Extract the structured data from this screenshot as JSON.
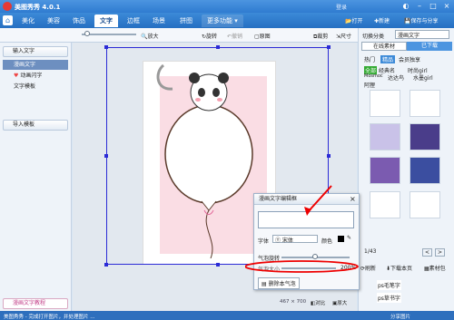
{
  "window": {
    "title": "美图秀秀 4.0.1",
    "login": "登录"
  },
  "menu": {
    "tabs": [
      "美化",
      "美容",
      "饰品",
      "文字",
      "边框",
      "场景",
      "拼图",
      "更多功能"
    ],
    "active": "文字"
  },
  "top_tools": {
    "open": "打开",
    "new": "新建",
    "save": "保存与分享"
  },
  "toolbar": {
    "zoom_label": "放大",
    "rotate": "旋转",
    "redo": "撤销",
    "original": "原图",
    "cut": "裁剪",
    "size": "尺寸"
  },
  "left": {
    "input_text": "输入文字",
    "selected": "漫画文字",
    "anim": "动画闪字",
    "template": "文字模板",
    "import": "导入模板"
  },
  "right": {
    "category_label": "切换分类",
    "category_value": "漫画文字",
    "tab_online": "在线素材",
    "tab_used": "已下载",
    "subtabs": [
      "热门",
      "精品",
      "会员独享"
    ],
    "tags": [
      "全部",
      "经典名",
      "时尚girl",
      "Mosmoc",
      "达达鸟",
      "水墨girl",
      "阿狸"
    ],
    "page": "1/43",
    "pagebtns": [
      "<",
      ">"
    ],
    "refresh": "刷新",
    "download": "下载本页",
    "materials": "素材包",
    "suffix1": "ps毛笔字",
    "suffix2": "ps草书字"
  },
  "dialog": {
    "title": "漫画文字编辑框",
    "font_label": "字体",
    "font_value": "宋体",
    "color_label": "颜色",
    "bubble_rotate": "气泡旋转",
    "bubble_size": "气泡大小",
    "size_value": "200%",
    "delete": "删除本气泡"
  },
  "canvas": {
    "size_label": "467 × 700",
    "compare": "对比",
    "origin": "原大"
  },
  "status": {
    "text": "美图秀秀 - 完成打开图片，并处理图片 ...",
    "count": "分享图片"
  },
  "bottom_left": "漫画文字教程"
}
